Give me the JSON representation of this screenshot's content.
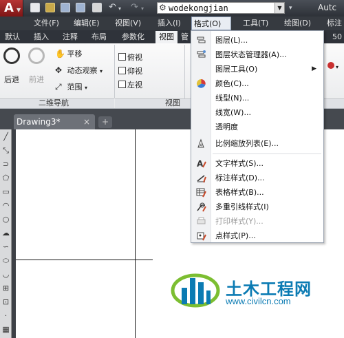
{
  "app": {
    "logo_letter": "A",
    "workspace_value": "wodekongjian",
    "title_fragment": "Autc"
  },
  "menubar": {
    "items": [
      "文件(F)",
      "编辑(E)",
      "视图(V)",
      "插入(I)",
      "格式(O)",
      "工具(T)",
      "绘图(D)",
      "标注"
    ],
    "active_index": 4
  },
  "ribbon_tabs": {
    "items": [
      "默认",
      "插入",
      "注释",
      "布局",
      "参数化",
      "视图",
      "管",
      "50"
    ],
    "active_index": 5
  },
  "ribbon": {
    "back_label": "后退",
    "forward_label": "前进",
    "pan_label": "平移",
    "orbit_label": "动态观察",
    "extents_label": "范围",
    "top_view": "俯视",
    "bottom_view": "仰视",
    "left_view": "左视",
    "nav_panel_title": "二维导航",
    "view_panel_title": "视图"
  },
  "document": {
    "tab_title": "Drawing3*",
    "close_symbol": "×",
    "new_tab_symbol": "+"
  },
  "format_menu": {
    "items": [
      {
        "label": "图层(L)...",
        "icon": "layer-icon"
      },
      {
        "label": "图层状态管理器(A)...",
        "icon": "layer-state-icon"
      },
      {
        "label": "图层工具(O)",
        "icon": "",
        "submenu": true
      },
      {
        "label": "颜色(C)...",
        "icon": "color-wheel-icon"
      },
      {
        "label": "线型(N)...",
        "icon": ""
      },
      {
        "label": "线宽(W)...",
        "icon": ""
      },
      {
        "label": "透明度",
        "icon": ""
      },
      {
        "label": "比例缩放列表(E)...",
        "icon": "scale-list-icon"
      },
      {
        "label": "文字样式(S)...",
        "icon": "text-style-icon"
      },
      {
        "label": "标注样式(D)...",
        "icon": "dim-style-icon"
      },
      {
        "label": "表格样式(B)...",
        "icon": "table-style-icon"
      },
      {
        "label": "多重引线样式(I)",
        "icon": "mleader-style-icon"
      },
      {
        "label": "打印样式(Y)...",
        "icon": "plot-style-icon",
        "disabled": true
      },
      {
        "label": "点样式(P)...",
        "icon": "point-style-icon"
      }
    ]
  },
  "watermark": {
    "brand": "土木工程网",
    "url": "www.civilcn.com"
  },
  "colors": {
    "accent_blue": "#0b7bb3",
    "logo_red": "#b53434",
    "dark_bar": "#363a40"
  }
}
